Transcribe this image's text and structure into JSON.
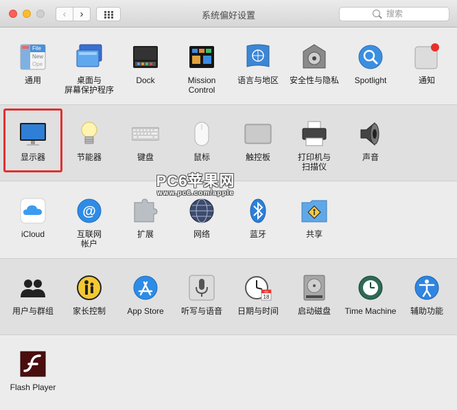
{
  "window": {
    "title": "系统偏好设置"
  },
  "search": {
    "placeholder": "搜索"
  },
  "watermark": {
    "line1": "PC6苹果网",
    "line2": "www.pc6.com/apple"
  },
  "sections": [
    {
      "items": [
        {
          "label": "通用",
          "icon": "general-icon"
        },
        {
          "label": "桌面与\n屏幕保护程序",
          "icon": "desktop-screensaver-icon"
        },
        {
          "label": "Dock",
          "icon": "dock-icon"
        },
        {
          "label": "Mission\nControl",
          "icon": "mission-control-icon"
        },
        {
          "label": "语言与地区",
          "icon": "language-region-icon"
        },
        {
          "label": "安全性与隐私",
          "icon": "security-privacy-icon"
        },
        {
          "label": "Spotlight",
          "icon": "spotlight-icon"
        },
        {
          "label": "通知",
          "icon": "notifications-icon"
        }
      ]
    },
    {
      "items": [
        {
          "label": "显示器",
          "icon": "displays-icon"
        },
        {
          "label": "节能器",
          "icon": "energy-saver-icon"
        },
        {
          "label": "键盘",
          "icon": "keyboard-icon"
        },
        {
          "label": "鼠标",
          "icon": "mouse-icon"
        },
        {
          "label": "触控板",
          "icon": "trackpad-icon"
        },
        {
          "label": "打印机与\n扫描仪",
          "icon": "printers-scanners-icon"
        },
        {
          "label": "声音",
          "icon": "sound-icon"
        }
      ]
    },
    {
      "items": [
        {
          "label": "iCloud",
          "icon": "icloud-icon"
        },
        {
          "label": "互联网\n帐户",
          "icon": "internet-accounts-icon"
        },
        {
          "label": "扩展",
          "icon": "extensions-icon"
        },
        {
          "label": "网络",
          "icon": "network-icon"
        },
        {
          "label": "蓝牙",
          "icon": "bluetooth-icon"
        },
        {
          "label": "共享",
          "icon": "sharing-icon"
        }
      ]
    },
    {
      "items": [
        {
          "label": "用户与群组",
          "icon": "users-groups-icon"
        },
        {
          "label": "家长控制",
          "icon": "parental-controls-icon"
        },
        {
          "label": "App Store",
          "icon": "app-store-icon"
        },
        {
          "label": "听写与语音",
          "icon": "dictation-speech-icon"
        },
        {
          "label": "日期与时间",
          "icon": "date-time-icon"
        },
        {
          "label": "启动磁盘",
          "icon": "startup-disk-icon"
        },
        {
          "label": "Time Machine",
          "icon": "time-machine-icon"
        },
        {
          "label": "辅助功能",
          "icon": "accessibility-icon"
        }
      ]
    },
    {
      "items": [
        {
          "label": "Flash Player",
          "icon": "flash-player-icon"
        }
      ]
    }
  ],
  "calendar": {
    "month": "JUL",
    "day": "18"
  },
  "general_icon_text": {
    "l1": "File",
    "l2": "New",
    "l3": "Ope"
  }
}
